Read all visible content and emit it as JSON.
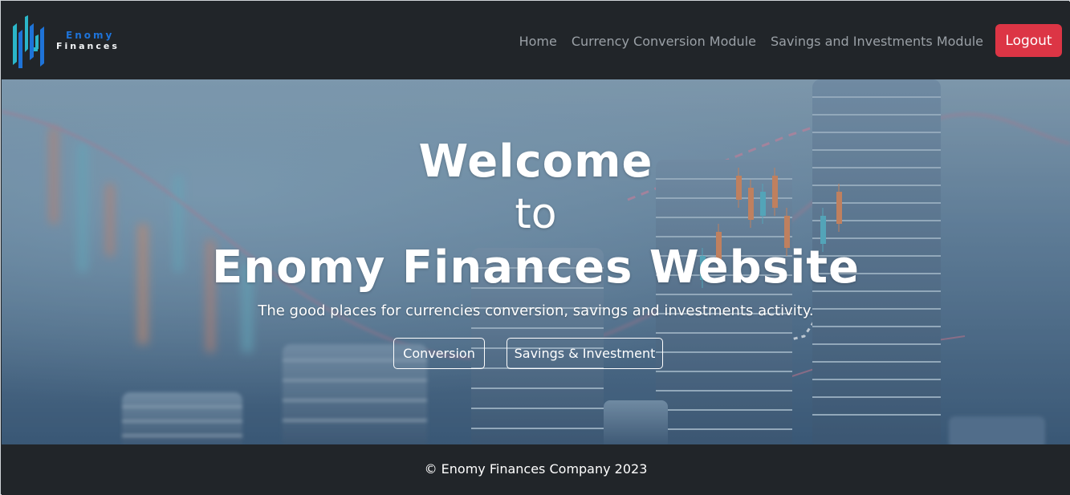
{
  "brand": {
    "name_top": "Enomy",
    "name_bottom": "Finances",
    "colors": {
      "blue": "#1e73d8",
      "teal": "#2bb6c8"
    }
  },
  "nav": {
    "items": [
      {
        "label": "Home"
      },
      {
        "label": "Currency Conversion Module"
      },
      {
        "label": "Savings and Investments Module"
      }
    ],
    "logout_label": "Logout",
    "logout_color": "#dc3545"
  },
  "hero": {
    "line1": "Welcome",
    "line2": "to",
    "line3": "Enomy Finances Website",
    "tagline": "The good places for currencies conversion, savings and investments activity.",
    "buttons": {
      "conversion": "Conversion",
      "savings": "Savings & Investment"
    }
  },
  "footer": {
    "copyright": "© Enomy Finances Company 2023"
  }
}
